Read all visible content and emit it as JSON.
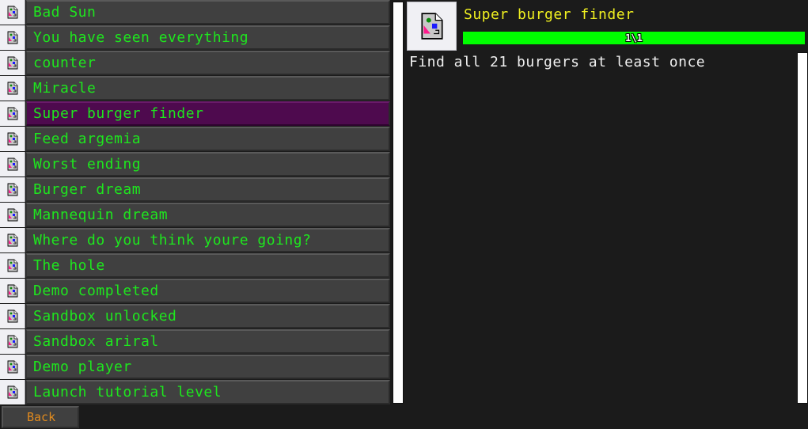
{
  "achievements": [
    {
      "label": "Bad Sun",
      "icon": "broken-image-icon",
      "selected": false
    },
    {
      "label": "You have seen everything",
      "icon": "broken-image-icon",
      "selected": false
    },
    {
      "label": "counter",
      "icon": "broken-image-icon",
      "selected": false
    },
    {
      "label": "Miracle",
      "icon": "broken-image-icon",
      "selected": false
    },
    {
      "label": "Super burger finder",
      "icon": "broken-image-icon",
      "selected": true
    },
    {
      "label": "Feed argemia",
      "icon": "broken-image-icon",
      "selected": false
    },
    {
      "label": "Worst ending",
      "icon": "broken-image-icon",
      "selected": false
    },
    {
      "label": "Burger dream",
      "icon": "broken-image-icon",
      "selected": false
    },
    {
      "label": "Mannequin dream",
      "icon": "broken-image-icon",
      "selected": false
    },
    {
      "label": "Where do you think youre going?",
      "icon": "broken-image-icon",
      "selected": false
    },
    {
      "label": "The hole",
      "icon": "broken-image-icon",
      "selected": false
    },
    {
      "label": "Demo completed",
      "icon": "broken-image-icon",
      "selected": false
    },
    {
      "label": "Sandbox unlocked",
      "icon": "broken-image-icon",
      "selected": false
    },
    {
      "label": "Sandbox ariral",
      "icon": "broken-image-icon",
      "selected": false
    },
    {
      "label": "Demo player",
      "icon": "broken-image-icon",
      "selected": false
    },
    {
      "label": "Launch tutorial level",
      "icon": "broken-image-icon",
      "selected": false
    }
  ],
  "detail": {
    "title": "Super burger finder",
    "progress_text": "1\\1",
    "progress_fraction": 1.0,
    "description": "Find all 21 burgers at least once"
  },
  "footer": {
    "back_label": "Back"
  },
  "colors": {
    "item_text": "#1ee61e",
    "selected_bg": "#4e0a4e",
    "title_text": "#f0f020",
    "progress_fill": "#00ff00",
    "back_text": "#e08a1e"
  }
}
